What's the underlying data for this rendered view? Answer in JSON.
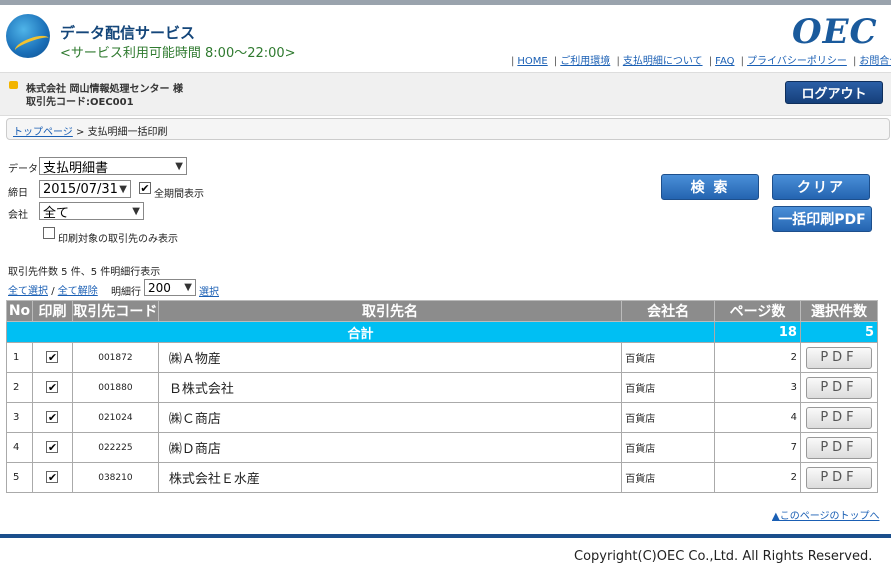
{
  "header": {
    "title": "データ配信サービス",
    "hours": "<サービス利用可能時間 8:00〜22:00>",
    "logo_text": "OEC",
    "nav": [
      "HOME",
      "ご利用環境",
      "支払明細について",
      "FAQ",
      "プライバシーポリシー",
      "お問合せ先"
    ]
  },
  "user": {
    "company": "株式会社 岡山情報処理センター 様",
    "code": "取引先コード:OEC001",
    "logout": "ログアウト"
  },
  "breadcrumb": {
    "home": "トップページ",
    "separator": " > ",
    "current": "支払明細一括印刷"
  },
  "form": {
    "data_label": "データ",
    "data_value": "支払明細書",
    "date_label": "締日",
    "date_value": "2015/07/31",
    "all_period_label": "全期間表示",
    "company_label": "会社",
    "company_value": "全て",
    "print_only_label": "印刷対象の取引先のみ表示"
  },
  "buttons": {
    "search": "検 索",
    "clear": "クリア",
    "bulk_pdf": "一括印刷PDF"
  },
  "summary": "取引先件数 5 件、5 件明細行表示",
  "select_controls": {
    "select_all": "全て選択",
    "slash": "/",
    "deselect_all": "全て解除",
    "rows_label": "明細行",
    "rows_value": "200",
    "select": "選択"
  },
  "table": {
    "headers": [
      "No",
      "印刷",
      "取引先コード",
      "取引先名",
      "会社名",
      "ページ数",
      "選択件数"
    ],
    "total": {
      "label": "合計",
      "pages": "18",
      "selected": "5"
    },
    "pdf_label": "PDF",
    "rows": [
      {
        "no": "1",
        "code": "001872",
        "name": "㈱Ａ物産",
        "company": "百貨店",
        "pages": "2"
      },
      {
        "no": "2",
        "code": "001880",
        "name": "Ｂ株式会社",
        "company": "百貨店",
        "pages": "3"
      },
      {
        "no": "3",
        "code": "021024",
        "name": "㈱Ｃ商店",
        "company": "百貨店",
        "pages": "4"
      },
      {
        "no": "4",
        "code": "022225",
        "name": "㈱Ｄ商店",
        "company": "百貨店",
        "pages": "7"
      },
      {
        "no": "5",
        "code": "038210",
        "name": "株式会社Ｅ水産",
        "company": "百貨店",
        "pages": "2"
      }
    ]
  },
  "page_top": "▲このページのトップへ",
  "copyright": "Copyright(C)OEC Co.,Ltd. All Rights Reserved."
}
